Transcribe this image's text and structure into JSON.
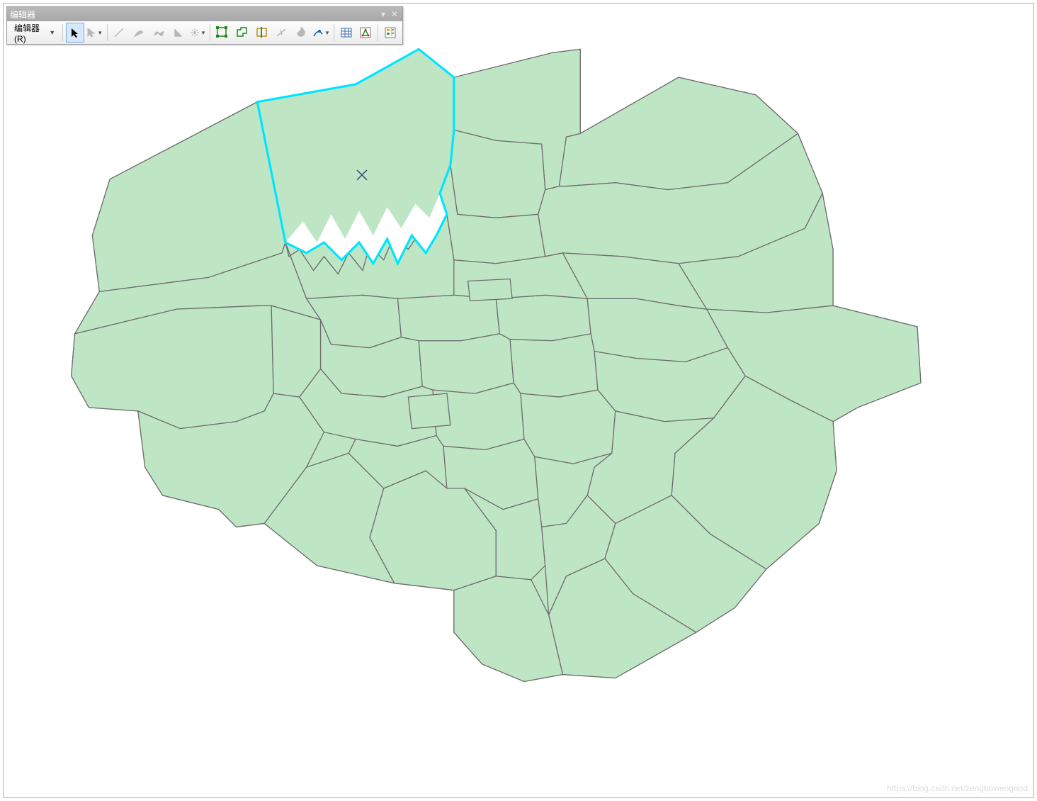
{
  "toolbar": {
    "title": "编辑器",
    "menu_label": "编辑器(R)",
    "buttons": [
      {
        "name": "edit-tool",
        "interact": true,
        "selected": true,
        "disabled": false
      },
      {
        "name": "edit-annotation-tool",
        "interact": true,
        "selected": false,
        "disabled": true,
        "caret": true
      },
      {
        "name": "straight-segment",
        "interact": true,
        "selected": false,
        "disabled": true
      },
      {
        "name": "end-point-arc",
        "interact": true,
        "selected": false,
        "disabled": true
      },
      {
        "name": "trace-tool",
        "interact": true,
        "selected": false,
        "disabled": true
      },
      {
        "name": "right-angle",
        "interact": true,
        "selected": false,
        "disabled": true
      },
      {
        "name": "midpoint-tool",
        "interact": true,
        "selected": false,
        "disabled": true,
        "caret": true
      },
      {
        "name": "edit-vertices",
        "interact": true,
        "selected": false,
        "disabled": false
      },
      {
        "name": "reshape-feature",
        "interact": true,
        "selected": false,
        "disabled": false
      },
      {
        "name": "cut-polygons",
        "interact": true,
        "selected": false,
        "disabled": false
      },
      {
        "name": "split-tool",
        "interact": true,
        "selected": false,
        "disabled": true
      },
      {
        "name": "rotate-tool",
        "interact": true,
        "selected": false,
        "disabled": true
      },
      {
        "name": "point-tool",
        "interact": true,
        "selected": false,
        "disabled": false,
        "caret": true
      },
      {
        "name": "attributes-window",
        "interact": true,
        "selected": false,
        "disabled": false
      },
      {
        "name": "sketch-properties",
        "interact": true,
        "selected": false,
        "disabled": false
      },
      {
        "name": "create-features",
        "interact": true,
        "selected": false,
        "disabled": false
      }
    ]
  },
  "map": {
    "fill_color": "#bfe6c4",
    "stroke_color": "#6e6e6e",
    "selected_stroke": "#00e5ff",
    "vertex_marker": "×",
    "vertex_marker_color": "#3b4a7a"
  },
  "watermark": "https://blog.csdn.net/zengbowengood"
}
